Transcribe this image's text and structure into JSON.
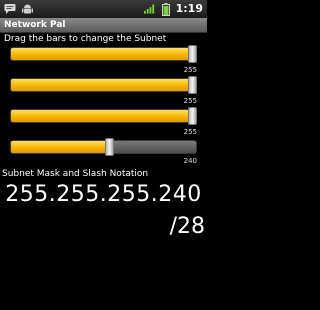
{
  "status_bar": {
    "left_icons": [
      "message-icon",
      "android-debug-icon"
    ],
    "right_icons": [
      "signal-3g-icon",
      "battery-icon"
    ],
    "time": "1:19"
  },
  "app": {
    "title": "Network Pal"
  },
  "instructions": "Drag the bars to change the Subnet",
  "octets": [
    {
      "value": 255,
      "label": "255"
    },
    {
      "value": 255,
      "label": "255"
    },
    {
      "value": 255,
      "label": "255"
    },
    {
      "value": 240,
      "label": "240"
    }
  ],
  "result": {
    "heading": "Subnet Mask and Slash Notation",
    "mask": "255.255.255.240",
    "slash": "/28"
  },
  "colors": {
    "accent": "#f7b500",
    "title_bar": "#707070"
  }
}
